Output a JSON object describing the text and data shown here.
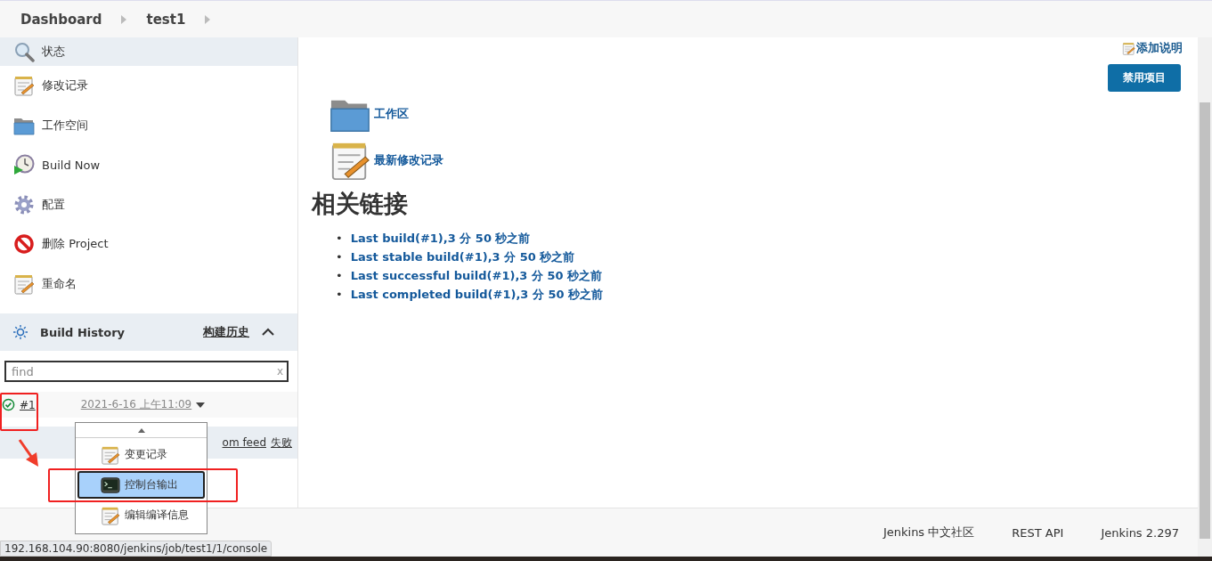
{
  "breadcrumbs": [
    {
      "label": "Dashboard"
    },
    {
      "label": "test1"
    }
  ],
  "sidebar": {
    "items": [
      {
        "label": "状态",
        "kind": "search",
        "selected": true
      },
      {
        "label": "修改记录",
        "kind": "notepad",
        "selected": false
      },
      {
        "label": "工作空间",
        "kind": "folder",
        "selected": false
      },
      {
        "label": "Build Now",
        "kind": "clock",
        "selected": false
      },
      {
        "label": "配置",
        "kind": "gear",
        "selected": false
      },
      {
        "label": "删除 Project",
        "kind": "forbidden",
        "selected": false
      },
      {
        "label": "重命名",
        "kind": "notepad",
        "selected": false
      }
    ]
  },
  "build_history": {
    "title": "Build History",
    "trend_link": "构建历史",
    "expanded": true,
    "search": {
      "placeholder": "find",
      "clear": "x"
    },
    "builds": [
      {
        "number": "#1",
        "date": "2021-6-16 上午11:09",
        "kind": "success"
      }
    ],
    "feed": {
      "partial": "om feed",
      "failed": "失败"
    }
  },
  "menu": {
    "items": [
      {
        "label": "变更记录",
        "kind": "notepad",
        "selected": false
      },
      {
        "label": "控制台输出",
        "kind": "terminal",
        "selected": true
      },
      {
        "label": "编辑编译信息",
        "kind": "notepad",
        "selected": false
      }
    ]
  },
  "main": {
    "add_description": "添加说明",
    "disable_button": "禁用项目",
    "links": [
      {
        "label": "工作区",
        "kind": "folder"
      },
      {
        "label": "最新修改记录",
        "kind": "notepad"
      }
    ],
    "related_heading": "相关链接",
    "related_links": [
      {
        "bullet": "•",
        "label": "Last build(#1),3 分 50 秒之前"
      },
      {
        "bullet": "•",
        "label": "Last stable build(#1),3 分 50 秒之前"
      },
      {
        "bullet": "•",
        "label": "Last successful build(#1),3 分 50 秒之前"
      },
      {
        "bullet": "•",
        "label": "Last completed build(#1),3 分 50 秒之前"
      }
    ]
  },
  "footer": {
    "links": [
      "Jenkins 中文社区",
      "REST API",
      "Jenkins 2.297"
    ]
  },
  "status_url": "192.168.104.90:8080/jenkins/job/test1/1/console"
}
